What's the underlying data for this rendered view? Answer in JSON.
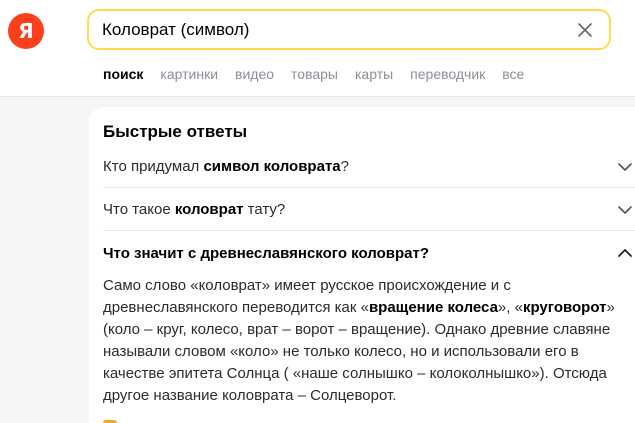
{
  "logo": {
    "letter": "Я"
  },
  "search": {
    "value": "Коловрат (символ)"
  },
  "tabs": [
    {
      "label": "поиск",
      "active": true
    },
    {
      "label": "картинки"
    },
    {
      "label": "видео"
    },
    {
      "label": "товары"
    },
    {
      "label": "карты"
    },
    {
      "label": "переводчик"
    },
    {
      "label": "все"
    }
  ],
  "quick_answers": {
    "title": "Быстрые ответы",
    "questions": [
      {
        "pre": "Кто придумал ",
        "bold": "символ коловрата",
        "post": "?"
      },
      {
        "pre": "Что такое ",
        "bold": "коловрат",
        "post": " тату?"
      }
    ],
    "open_question": "Что значит с древнеславянского коловрат?",
    "answer": {
      "p1": "Само слово «коловрат» имеет русское происхождение и с древнеславянского переводится как «",
      "b1": "вращение колеса",
      "p2": "», «",
      "b2": "круговорот",
      "p3": "» (коло – круг, колесо, врат – ворот – вращение). Однако древние славяне называли словом «коло» не только колесо, но и использовали его в качестве эпитета Солнца ( «наше солнышко – колоколнышко»). Отсюда другое название коловрата – Солцеворот."
    }
  },
  "colors": {
    "brand": "#fc3f1d",
    "search_border": "#ffdb4d"
  }
}
